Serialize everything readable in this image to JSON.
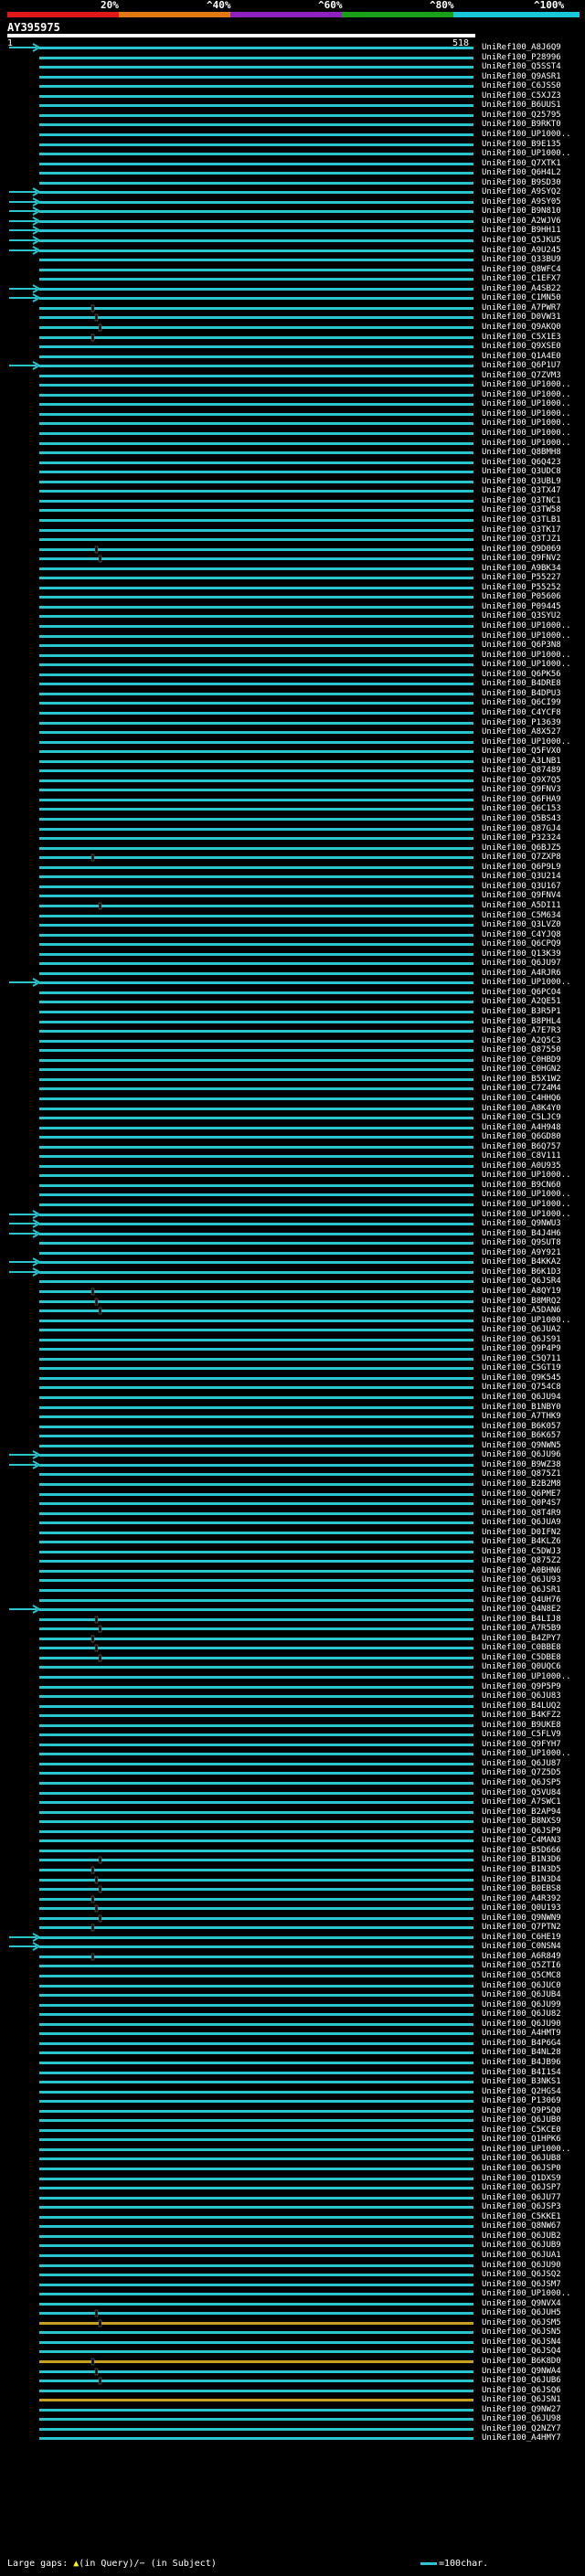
{
  "header": {
    "title": "AY395975",
    "query_start": "1",
    "query_end": "518",
    "scale_labels": [
      "20%",
      "^40%",
      "^60%",
      "^80%",
      "^100%"
    ],
    "scale_colors": [
      "#e01818",
      "#e07a10",
      "#9020c0",
      "#18a018",
      "#18c8d8"
    ]
  },
  "colors": {
    "hit": "#2bc4cc",
    "hit_low": "#c8a020",
    "gap_subject": "#000000",
    "gap_query": "#ffff00"
  },
  "footer": {
    "label": "Large gaps:",
    "query_gap": "(in Query)/",
    "subject_gap": "(in Subject)",
    "legend": "=100char."
  },
  "hits": [
    "UniRef100_A8J6Q9",
    "UniRef100_P28996",
    "UniRef100_Q5SST4",
    "UniRef100_Q9ASR1",
    "UniRef100_C6JSS0",
    "UniRef100_C5XJZ3",
    "UniRef100_B6UUS1",
    "UniRef100_Q25795",
    "UniRef100_B9RKT0",
    "UniRef100_UP1000..",
    "UniRef100_B9E135",
    "UniRef100_UP1000..",
    "UniRef100_Q7XTK1",
    "UniRef100_Q6H4L2",
    "UniRef100_B9SD30",
    "UniRef100_A9SYQ2",
    "UniRef100_A9SY05",
    "UniRef100_B9N810",
    "UniRef100_A2WJV6",
    "UniRef100_B9HH11",
    "UniRef100_Q5JKU5",
    "UniRef100_A9U245",
    "UniRef100_Q33BU9",
    "UniRef100_Q8WFC4",
    "UniRef100_C1EFX7",
    "UniRef100_A4SB22",
    "UniRef100_C1MN50",
    "UniRef100_A7PWR7",
    "UniRef100_D0VW31",
    "UniRef100_Q9AKQ0",
    "UniRef100_C5X1E3",
    "UniRef100_Q9XSE0",
    "UniRef100_Q1A4E0",
    "UniRef100_Q6P1U7",
    "UniRef100_Q7ZVM3",
    "UniRef100_UP1000..",
    "UniRef100_UP1000..",
    "UniRef100_UP1000..",
    "UniRef100_UP1000..",
    "UniRef100_UP1000..",
    "UniRef100_UP1000..",
    "UniRef100_UP1000..",
    "UniRef100_Q8BMH8",
    "UniRef100_Q6Q423",
    "UniRef100_Q3UDC8",
    "UniRef100_Q3UBL9",
    "UniRef100_Q3TX47",
    "UniRef100_Q3TNC1",
    "UniRef100_Q3TW58",
    "UniRef100_Q3TLB1",
    "UniRef100_Q3TK17",
    "UniRef100_Q3TJZ1",
    "UniRef100_Q9D069",
    "UniRef100_Q9FNV2",
    "UniRef100_A9BK34",
    "UniRef100_P55227",
    "UniRef100_P55252",
    "UniRef100_P05606",
    "UniRef100_P09445",
    "UniRef100_Q3SYU2",
    "UniRef100_UP1000..",
    "UniRef100_UP1000..",
    "UniRef100_Q6P3N8",
    "UniRef100_UP1000..",
    "UniRef100_UP1000..",
    "UniRef100_Q6PK56",
    "UniRef100_B4DRE8",
    "UniRef100_B4DPU3",
    "UniRef100_Q6CI99",
    "UniRef100_C4YCF8",
    "UniRef100_P13639",
    "UniRef100_A8X527",
    "UniRef100_UP1000..",
    "UniRef100_Q5FVX0",
    "UniRef100_A3LNB1",
    "UniRef100_Q87489",
    "UniRef100_Q9X7Q5",
    "UniRef100_Q9FNV3",
    "UniRef100_Q6FHA9",
    "UniRef100_Q6C153",
    "UniRef100_Q5BS43",
    "UniRef100_Q87GJ4",
    "UniRef100_P32324",
    "UniRef100_Q6BJZ5",
    "UniRef100_Q7ZXP8",
    "UniRef100_Q6P9L9",
    "UniRef100_Q3U214",
    "UniRef100_Q3U167",
    "UniRef100_Q9FNV4",
    "UniRef100_A5DI11",
    "UniRef100_C5M634",
    "UniRef100_Q3LVZ0",
    "UniRef100_C4YJQ8",
    "UniRef100_Q6CPQ9",
    "UniRef100_Q13K39",
    "UniRef100_Q6JU97",
    "UniRef100_A4RJR6",
    "UniRef100_UP1000..",
    "UniRef100_Q6PCO4",
    "UniRef100_A2QE51",
    "UniRef100_B3R5P1",
    "UniRef100_B8PHL4",
    "UniRef100_A7E7R3",
    "UniRef100_A2Q5C3",
    "UniRef100_Q87550",
    "UniRef100_C0HBD9",
    "UniRef100_C0HGN2",
    "UniRef100_B5X1W2",
    "UniRef100_C7Z4M4",
    "UniRef100_C4HHQ6",
    "UniRef100_A8K4Y0",
    "UniRef100_C5LJC9",
    "UniRef100_A4H948",
    "UniRef100_Q6GD80",
    "UniRef100_B6Q757",
    "UniRef100_C8V111",
    "UniRef100_A0U935",
    "UniRef100_UP1000..",
    "UniRef100_B9CN60",
    "UniRef100_UP1000..",
    "UniRef100_UP1000..",
    "UniRef100_UP1000..",
    "UniRef100_Q9NWU3",
    "UniRef100_B4J4H6",
    "UniRef100_Q9SUT8",
    "UniRef100_A9Y921",
    "UniRef100_B4KKA2",
    "UniRef100_B6K1D3",
    "UniRef100_Q6JSR4",
    "UniRef100_A8QY19",
    "UniRef100_B8MRQ2",
    "UniRef100_A5DAN6",
    "UniRef100_UP1000..",
    "UniRef100_Q6JUA2",
    "UniRef100_Q6JS91",
    "UniRef100_Q9P4P9",
    "UniRef100_C5Q711",
    "UniRef100_C5GT19",
    "UniRef100_Q9K545",
    "UniRef100_Q754C8",
    "UniRef100_Q6JU94",
    "UniRef100_B1NBY0",
    "UniRef100_A7THK9",
    "UniRef100_B6K057",
    "UniRef100_B6K657",
    "UniRef100_Q9NWN5",
    "UniRef100_Q6JU96",
    "UniRef100_B9WZ38",
    "UniRef100_Q875Z1",
    "UniRef100_B2B2M8",
    "UniRef100_Q6PME7",
    "UniRef100_Q0P4S7",
    "UniRef100_Q8T4R9",
    "UniRef100_Q6JUA9",
    "UniRef100_D0IFN2",
    "UniRef100_B4KLZ6",
    "UniRef100_C5DWJ3",
    "UniRef100_Q875Z2",
    "UniRef100_A0BHN6",
    "UniRef100_Q6JU93",
    "UniRef100_Q6JSR1",
    "UniRef100_Q4UH76",
    "UniRef100_Q4N8E2",
    "UniRef100_B4LIJ8",
    "UniRef100_A7R5B9",
    "UniRef100_B4ZPY7",
    "UniRef100_C0BBE8",
    "UniRef100_C5DBE8",
    "UniRef100_Q0UQC6",
    "UniRef100_UP1000..",
    "UniRef100_Q9P5P9",
    "UniRef100_Q6JU83",
    "UniRef100_B4LUQ2",
    "UniRef100_B4KFZ2",
    "UniRef100_B9UKE8",
    "UniRef100_C5FLV9",
    "UniRef100_Q9FYH7",
    "UniRef100_UP1000..",
    "UniRef100_Q6JU87",
    "UniRef100_Q7Z5D5",
    "UniRef100_Q6JSP5",
    "UniRef100_Q5VU84",
    "UniRef100_A7SWC1",
    "UniRef100_B2AP94",
    "UniRef100_B8NXS9",
    "UniRef100_Q6JSP9",
    "UniRef100_C4MAN3",
    "UniRef100_B5D666",
    "UniRef100_B1N3D6",
    "UniRef100_B1N3D5",
    "UniRef100_B1N3D4",
    "UniRef100_B0EBS8",
    "UniRef100_A4R392",
    "UniRef100_Q0U193",
    "UniRef100_Q9NWN9",
    "UniRef100_Q7PTN2",
    "UniRef100_C6HE19",
    "UniRef100_C0NSN4",
    "UniRef100_A6R849",
    "UniRef100_Q5ZTI6",
    "UniRef100_Q5CMC8",
    "UniRef100_Q6JUC0",
    "UniRef100_Q6JUB4",
    "UniRef100_Q6JU99",
    "UniRef100_Q6JU82",
    "UniRef100_Q6JU90",
    "UniRef100_A4HMT9",
    "UniRef100_B4P6G4",
    "UniRef100_B4NL28",
    "UniRef100_B4JB96",
    "UniRef100_B4I1S4",
    "UniRef100_B3NKS1",
    "UniRef100_Q2HGS4",
    "UniRef100_P13069",
    "UniRef100_Q9P5Q0",
    "UniRef100_Q6JUB0",
    "UniRef100_C5KCE0",
    "UniRef100_Q1HPK6",
    "UniRef100_UP1000..",
    "UniRef100_Q6JUB8",
    "UniRef100_Q6JSP0",
    "UniRef100_Q1DXS9",
    "UniRef100_Q6JSP7",
    "UniRef100_Q6JU77",
    "UniRef100_Q6JSP3",
    "UniRef100_C5KKE1",
    "UniRef100_Q8NW67",
    "UniRef100_Q6JUB2",
    "UniRef100_Q6JUB9",
    "UniRef100_Q6JUA1",
    "UniRef100_Q6JU90",
    "UniRef100_Q6JSQ2",
    "UniRef100_Q6JSM7",
    "UniRef100_UP1000..",
    "UniRef100_Q9NVX4",
    "UniRef100_Q6JUH5",
    "UniRef100_Q6JSM5",
    "UniRef100_Q6JSN5",
    "UniRef100_Q6JSN4",
    "UniRef100_Q6JSQ4",
    "UniRef100_B6K8D0",
    "UniRef100_Q9NWA4",
    "UniRef100_Q6JUB6",
    "UniRef100_Q6JSQ6",
    "UniRef100_Q6JSN1",
    "UniRef100_Q9NW27",
    "UniRef100_Q6JU98",
    "UniRef100_Q2NZY7",
    "UniRef100_A4HMY7"
  ]
}
